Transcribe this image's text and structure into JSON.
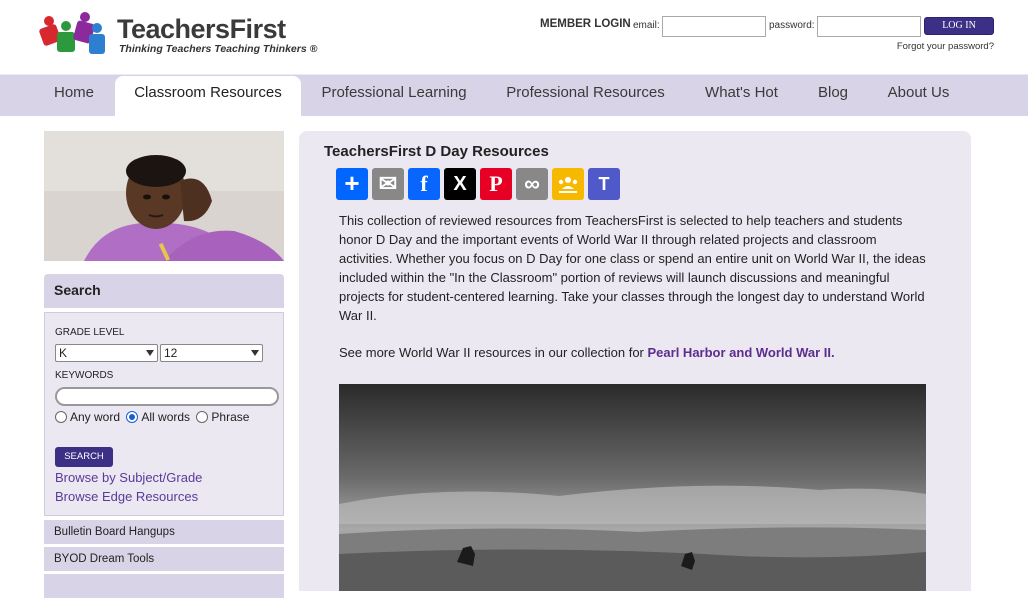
{
  "brand": {
    "name": "TeachersFirst",
    "tagline": "Thinking Teachers Teaching Thinkers ®"
  },
  "login": {
    "member_label": "MEMBER LOGIN",
    "email_label": "email:",
    "password_label": "password:",
    "button_label": "LOG IN",
    "forgot_label": "Forgot your password?"
  },
  "nav": {
    "items": [
      {
        "label": "Home"
      },
      {
        "label": "Classroom Resources"
      },
      {
        "label": "Professional Learning"
      },
      {
        "label": "Professional Resources"
      },
      {
        "label": "What's Hot"
      },
      {
        "label": "Blog"
      },
      {
        "label": "About Us"
      }
    ],
    "active_index": 1
  },
  "search": {
    "title": "Search",
    "grade_label": "GRADE LEVEL",
    "grade_from": "K",
    "grade_to": "12",
    "keywords_label": "KEYWORDS",
    "keywords_value": "",
    "options": [
      "Any word",
      "All words",
      "Phrase"
    ],
    "selected_option": "All words",
    "button_label": "SEARCH",
    "browse_subject": "Browse by Subject/Grade",
    "browse_edge": "Browse Edge Resources"
  },
  "sidebar": {
    "links": [
      {
        "label": "Bulletin Board Hangups"
      },
      {
        "label": "BYOD Dream Tools"
      }
    ]
  },
  "main": {
    "title": "TeachersFirst D Day Resources",
    "share_buttons": [
      {
        "name": "share-icon",
        "label": "+",
        "color": "#0166ff"
      },
      {
        "name": "email-icon",
        "label": "✉",
        "color": "#888888"
      },
      {
        "name": "facebook-icon",
        "label": "f",
        "color": "#0866ff"
      },
      {
        "name": "x-icon",
        "label": "X",
        "color": "#000000"
      },
      {
        "name": "pinterest-icon",
        "label": "P",
        "color": "#e60023"
      },
      {
        "name": "copy-link-icon",
        "label": "∞",
        "color": "#888888"
      },
      {
        "name": "google-classroom-icon",
        "label": "●",
        "color": "#f6b900"
      },
      {
        "name": "teams-icon",
        "label": "T",
        "color": "#5059c9"
      }
    ],
    "description": "This collection of reviewed resources from TeachersFirst is selected to help teachers and students honor D Day and the important events of World War II through related projects and classroom activities. Whether you focus on D Day for one class or spend an entire unit on World War II, the ideas included within the \"In the Classroom\" portion of reviews will launch discussions and meaningful projects for student-centered learning. Take your classes through the longest day to understand World War II.",
    "more_prefix": "See more World War II resources in our collection for ",
    "more_link": "Pearl Harbor and World War II."
  },
  "colors": {
    "nav_bg": "#d8d3e6",
    "panel_bg": "#ebe8f2",
    "button": "#3b2f86",
    "link": "#5b3a9a"
  }
}
